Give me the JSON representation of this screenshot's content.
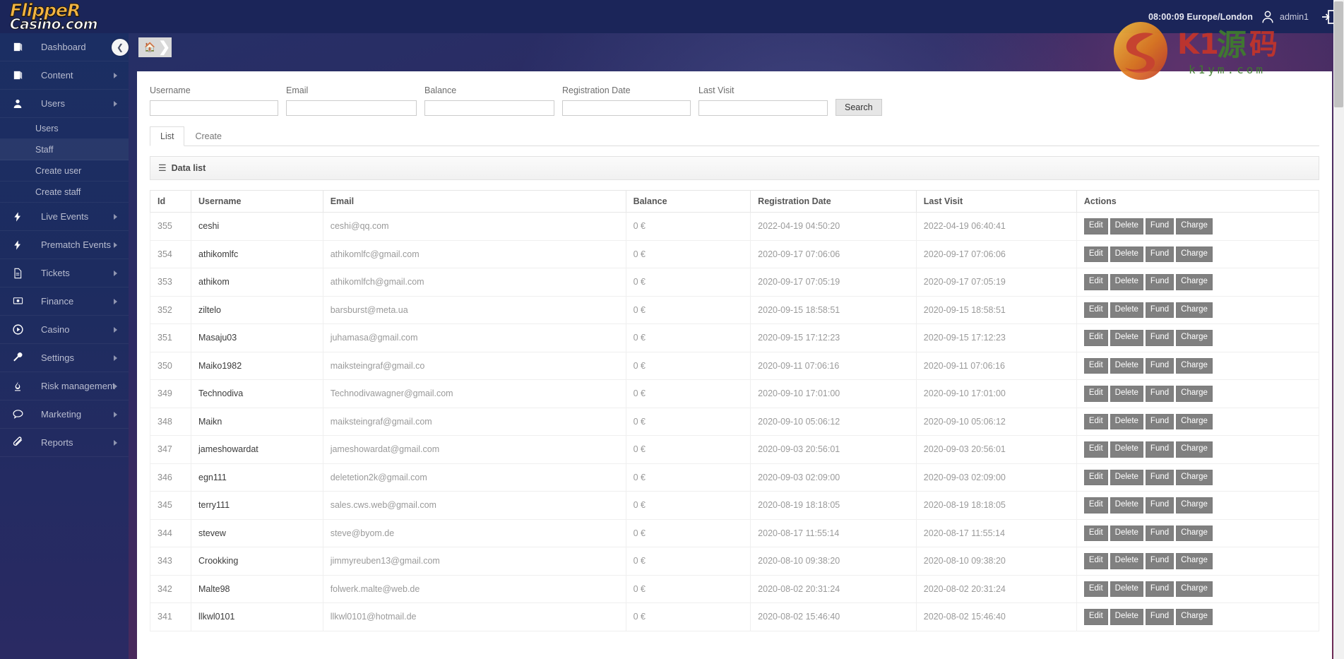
{
  "brand": {
    "line1": "FlippeR",
    "line2": "Casino.com"
  },
  "header": {
    "clock": "08:00:09 Europe/London",
    "username": "admin1",
    "avatar_icon": "user-avatar-icon",
    "logout_icon": "logout-icon"
  },
  "watermark": {
    "text": "K1源码",
    "sub": "k1ym.com"
  },
  "breadcrumb": {
    "home_icon": "home-icon",
    "arrow_icon": "chevron-right-icon"
  },
  "collapse": {
    "icon": "chevron-left-icon"
  },
  "sidebar": {
    "items": [
      {
        "label": "Dashboard",
        "icon": "book-icon",
        "caret": true,
        "sub": []
      },
      {
        "label": "Content",
        "icon": "book-icon",
        "caret": true,
        "sub": []
      },
      {
        "label": "Users",
        "icon": "user-icon",
        "caret": true,
        "sub": [
          "Users",
          "Staff",
          "Create user",
          "Create staff"
        ]
      },
      {
        "label": "Live Events",
        "icon": "bolt-icon",
        "caret": true,
        "sub": []
      },
      {
        "label": "Prematch Events",
        "icon": "bolt-icon",
        "caret": true,
        "sub": []
      },
      {
        "label": "Tickets",
        "icon": "file-icon",
        "caret": true,
        "sub": []
      },
      {
        "label": "Finance",
        "icon": "money-icon",
        "caret": true,
        "sub": []
      },
      {
        "label": "Casino",
        "icon": "play-circle-icon",
        "caret": true,
        "sub": []
      },
      {
        "label": "Settings",
        "icon": "wrench-icon",
        "caret": true,
        "sub": []
      },
      {
        "label": "Risk management",
        "icon": "flame-icon",
        "caret": true,
        "sub": []
      },
      {
        "label": "Marketing",
        "icon": "comment-icon",
        "caret": true,
        "sub": []
      },
      {
        "label": "Reports",
        "icon": "paperclip-icon",
        "caret": true,
        "sub": []
      }
    ],
    "active_sub": "Staff"
  },
  "filters": {
    "fields": [
      {
        "label": "Username",
        "value": "",
        "placeholder": ""
      },
      {
        "label": "Email",
        "value": "",
        "placeholder": ""
      },
      {
        "label": "Balance",
        "value": "",
        "placeholder": ""
      },
      {
        "label": "Registration Date",
        "value": "",
        "placeholder": ""
      },
      {
        "label": "Last Visit",
        "value": "",
        "placeholder": ""
      }
    ],
    "search_label": "Search"
  },
  "tabs": [
    {
      "label": "List",
      "active": true
    },
    {
      "label": "Create",
      "active": false
    }
  ],
  "datalist": {
    "title": "Data list",
    "hamburger_icon": "hamburger-icon"
  },
  "table": {
    "columns": [
      "Id",
      "Username",
      "Email",
      "Balance",
      "Registration Date",
      "Last Visit",
      "Actions"
    ],
    "actions": [
      "Edit",
      "Delete",
      "Fund",
      "Charge"
    ],
    "rows": [
      {
        "id": "355",
        "username": "ceshi",
        "email": "ceshi@qq.com",
        "balance": "0 €",
        "registration": "2022-04-19 04:50:20",
        "last_visit": "2022-04-19 06:40:41"
      },
      {
        "id": "354",
        "username": "athikomlfc",
        "email": "athikomlfc@gmail.com",
        "balance": "0 €",
        "registration": "2020-09-17 07:06:06",
        "last_visit": "2020-09-17 07:06:06"
      },
      {
        "id": "353",
        "username": "athikom",
        "email": "athikomlfch@gmail.com",
        "balance": "0 €",
        "registration": "2020-09-17 07:05:19",
        "last_visit": "2020-09-17 07:05:19"
      },
      {
        "id": "352",
        "username": "ziltelo",
        "email": "barsburst@meta.ua",
        "balance": "0 €",
        "registration": "2020-09-15 18:58:51",
        "last_visit": "2020-09-15 18:58:51"
      },
      {
        "id": "351",
        "username": "Masaju03",
        "email": "juhamasa@gmail.com",
        "balance": "0 €",
        "registration": "2020-09-15 17:12:23",
        "last_visit": "2020-09-15 17:12:23"
      },
      {
        "id": "350",
        "username": "Maiko1982",
        "email": "maiksteingraf@gmail.co",
        "balance": "0 €",
        "registration": "2020-09-11 07:06:16",
        "last_visit": "2020-09-11 07:06:16"
      },
      {
        "id": "349",
        "username": "Technodiva",
        "email": "Technodivawagner@gmail.com",
        "balance": "0 €",
        "registration": "2020-09-10 17:01:00",
        "last_visit": "2020-09-10 17:01:00"
      },
      {
        "id": "348",
        "username": "Maikn",
        "email": "maiksteingraf@gmail.com",
        "balance": "0 €",
        "registration": "2020-09-10 05:06:12",
        "last_visit": "2020-09-10 05:06:12"
      },
      {
        "id": "347",
        "username": "jameshowardat",
        "email": "jameshowardat@gmail.com",
        "balance": "0 €",
        "registration": "2020-09-03 20:56:01",
        "last_visit": "2020-09-03 20:56:01"
      },
      {
        "id": "346",
        "username": "egn111",
        "email": "deletetion2k@gmail.com",
        "balance": "0 €",
        "registration": "2020-09-03 02:09:00",
        "last_visit": "2020-09-03 02:09:00"
      },
      {
        "id": "345",
        "username": "terry111",
        "email": "sales.cws.web@gmail.com",
        "balance": "0 €",
        "registration": "2020-08-19 18:18:05",
        "last_visit": "2020-08-19 18:18:05"
      },
      {
        "id": "344",
        "username": "stevew",
        "email": "steve@byom.de",
        "balance": "0 €",
        "registration": "2020-08-17 11:55:14",
        "last_visit": "2020-08-17 11:55:14"
      },
      {
        "id": "343",
        "username": "Crookking",
        "email": "jimmyreuben13@gmail.com",
        "balance": "0 €",
        "registration": "2020-08-10 09:38:20",
        "last_visit": "2020-08-10 09:38:20"
      },
      {
        "id": "342",
        "username": "Malte98",
        "email": "folwerk.malte@web.de",
        "balance": "0 €",
        "registration": "2020-08-02 20:31:24",
        "last_visit": "2020-08-02 20:31:24"
      },
      {
        "id": "341",
        "username": "llkwl0101",
        "email": "llkwl0101@hotmail.de",
        "balance": "0 €",
        "registration": "2020-08-02 15:46:40",
        "last_visit": "2020-08-02 15:46:40"
      }
    ]
  }
}
